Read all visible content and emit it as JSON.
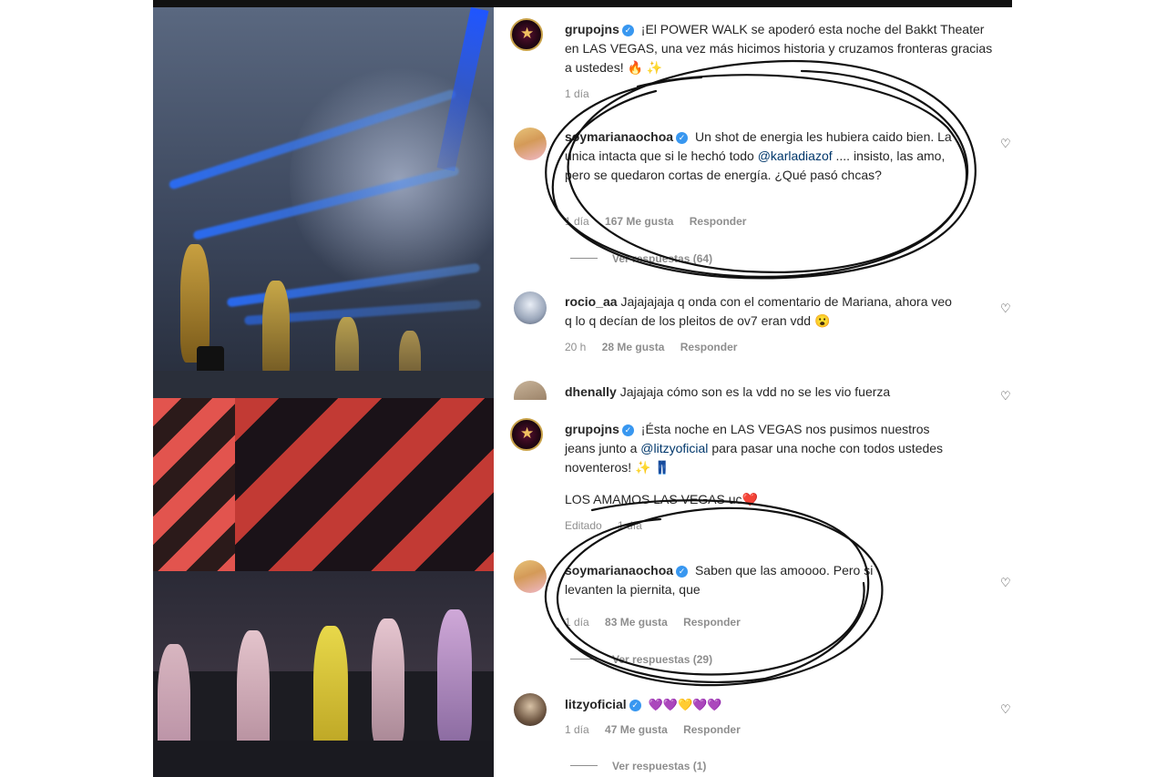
{
  "post_one": {
    "caption": {
      "username": "grupojns",
      "text": "¡El POWER WALK se apoderó esta noche del Bakkt Theater en LAS VEGAS, una vez más hicimos historia y cruzamos fronteras gracias a ustedes! 🔥 ✨",
      "time": "1 día"
    },
    "comments": [
      {
        "username": "soymarianaochoa",
        "text_before": "Un shot de energia les hubiera caido bien. La unica intacta que si le hechó todo",
        "mention": "@karladiazof",
        "text_after": ".... insisto, las amo, pero se quedaron cortas de energía. ¿Qué pasó chcas?",
        "time": "1 día",
        "likes": "167 Me gusta",
        "reply": "Responder",
        "view_replies": "Ver respuestas (64)"
      },
      {
        "username": "rocio_aa",
        "text": "Jajajajaja q onda con el comentario de Mariana, ahora veo q lo q decían de los pleitos de ov7 eran vdd 😮",
        "time": "20 h",
        "likes": "28 Me gusta",
        "reply": "Responder"
      },
      {
        "username": "dhenally",
        "text": "Jajajaja cómo son es la vdd no se les vio fuerza"
      }
    ]
  },
  "post_two": {
    "caption": {
      "username": "grupojns",
      "text_before": "¡Ésta noche en LAS VEGAS nos pusimos nuestros jeans junto a",
      "mention": "@litzyoficial",
      "text_after": "para pasar una noche con todos ustedes noventeros! ✨ 👖",
      "line2": "LOS AMAMOS LAS VEGAS uc❤️",
      "edited": "Editado",
      "time": "1 día"
    },
    "comments": [
      {
        "username": "soymarianaochoa",
        "text": "Saben que las amoooo. Pero si levanten la piernita, que",
        "time": "1 día",
        "likes": "83 Me gusta",
        "reply": "Responder",
        "view_replies": "Ver respuestas (29)"
      },
      {
        "username": "litzyoficial",
        "text": "💜💜💛💜💜",
        "time": "1 día",
        "likes": "47 Me gusta",
        "reply": "Responder",
        "view_replies": "Ver respuestas (1)"
      }
    ]
  },
  "colors": {
    "verified_badge": "#3897f0",
    "mention": "#00376b",
    "meta_gray": "#8e8e8e",
    "text": "#262626"
  },
  "icons": {
    "verified": "verified-badge-icon",
    "like": "heart-icon"
  }
}
